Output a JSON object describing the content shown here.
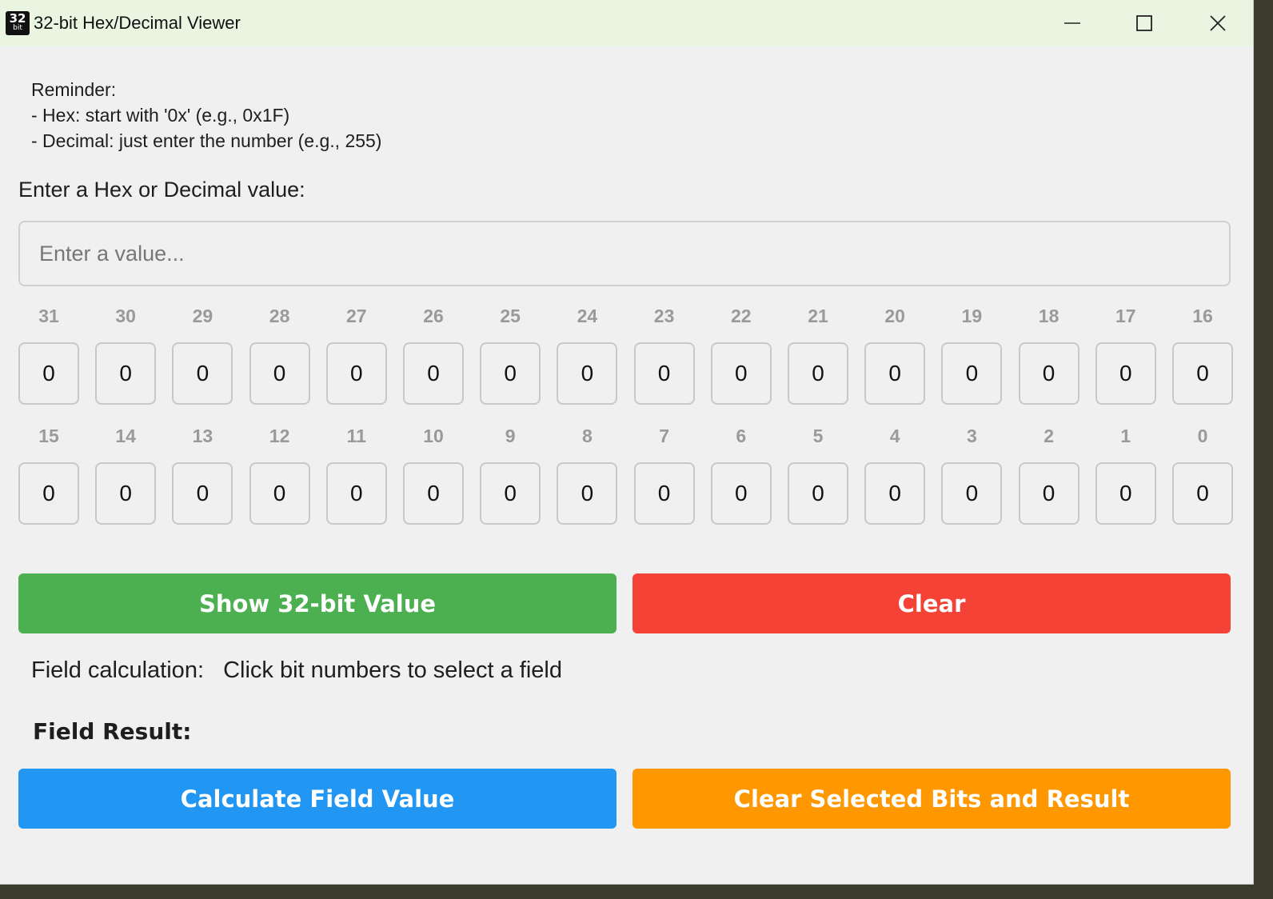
{
  "window": {
    "title": "32-bit Hex/Decimal Viewer",
    "icon_top": "32",
    "icon_bottom": "bit"
  },
  "reminder": {
    "heading": "Reminder:",
    "line1": "- Hex: start with '0x' (e.g., 0x1F)",
    "line2": "- Decimal: just enter the number (e.g., 255)"
  },
  "input": {
    "label": "Enter a Hex or Decimal value:",
    "placeholder": "Enter a value...",
    "value": ""
  },
  "bits_high": {
    "labels": [
      "31",
      "30",
      "29",
      "28",
      "27",
      "26",
      "25",
      "24",
      "23",
      "22",
      "21",
      "20",
      "19",
      "18",
      "17",
      "16"
    ],
    "values": [
      "0",
      "0",
      "0",
      "0",
      "0",
      "0",
      "0",
      "0",
      "0",
      "0",
      "0",
      "0",
      "0",
      "0",
      "0",
      "0"
    ]
  },
  "bits_low": {
    "labels": [
      "15",
      "14",
      "13",
      "12",
      "11",
      "10",
      "9",
      "8",
      "7",
      "6",
      "5",
      "4",
      "3",
      "2",
      "1",
      "0"
    ],
    "values": [
      "0",
      "0",
      "0",
      "0",
      "0",
      "0",
      "0",
      "0",
      "0",
      "0",
      "0",
      "0",
      "0",
      "0",
      "0",
      "0"
    ]
  },
  "buttons": {
    "show": "Show 32-bit Value",
    "clear": "Clear",
    "calculate": "Calculate Field Value",
    "clear_selected": "Clear Selected Bits and Result"
  },
  "field": {
    "calc_label": "Field calculation:",
    "calc_hint": "Click bit numbers to select a field",
    "result_label": "Field Result:"
  },
  "colors": {
    "show": "#4caf50",
    "clear": "#f44336",
    "calculate": "#2196f3",
    "clear_selected": "#ff9800"
  }
}
